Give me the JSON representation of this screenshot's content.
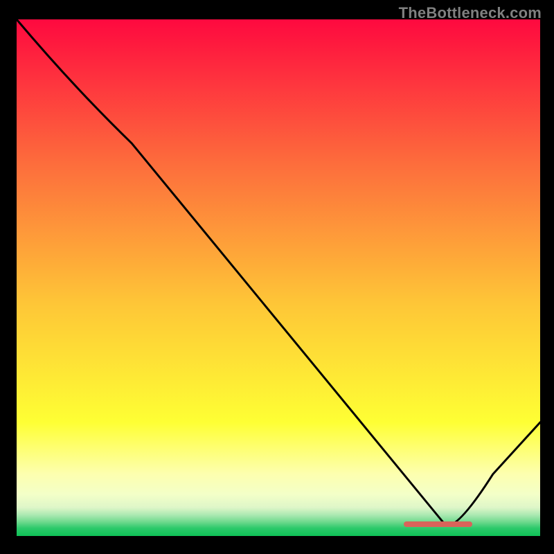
{
  "watermark": "TheBottleneck.com",
  "colors": {
    "top": "#fe093f",
    "mid1": "#fd6d3c",
    "mid2": "#fec637",
    "mid3": "#feff34",
    "pale1": "#fdffaf",
    "pale2": "#f3ffc8",
    "pale3": "#def6c8",
    "green1": "#a8e8b0",
    "green2": "#6dd98d",
    "green3": "#2bc96a",
    "bottom": "#0fc257",
    "curve": "#000000",
    "marker": "#d9635a"
  },
  "chart_data": {
    "type": "line",
    "xlim": [
      0,
      100
    ],
    "ylim": [
      0,
      100
    ],
    "x": [
      0,
      22,
      82,
      100
    ],
    "values": [
      100,
      76,
      2,
      22
    ],
    "title": "",
    "xlabel": "",
    "ylabel": "",
    "marker": {
      "x_start": 74,
      "x_end": 87,
      "y": 2.3
    }
  }
}
